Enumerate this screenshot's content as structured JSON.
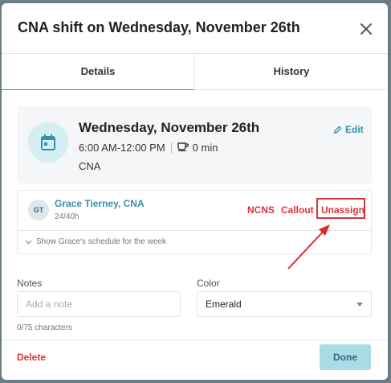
{
  "modal": {
    "title": "CNA shift on Wednesday, November 26th",
    "tabs": [
      {
        "label": "Details",
        "active": true
      },
      {
        "label": "History",
        "active": false
      }
    ]
  },
  "shift": {
    "date": "Wednesday, November 26th",
    "time": "6:00 AM-12:00 PM",
    "break": "0 min",
    "role": "CNA",
    "edit_label": "Edit"
  },
  "assignment": {
    "initials": "GT",
    "name": "Grace Tierney, CNA",
    "hours": "24/40h",
    "actions": [
      "NCNS",
      "Callout",
      "Unassign"
    ],
    "schedule_toggle": "Show Grace's schedule for the week"
  },
  "form": {
    "notes_label": "Notes",
    "notes_placeholder": "Add a note",
    "char_count": "0/75 characters",
    "color_label": "Color",
    "color_value": "Emerald"
  },
  "footer": {
    "delete_label": "Delete",
    "done_label": "Done"
  },
  "colors": {
    "accent": "#3a8fa8",
    "danger": "#d8333a",
    "done_bg": "#a9dce6"
  }
}
